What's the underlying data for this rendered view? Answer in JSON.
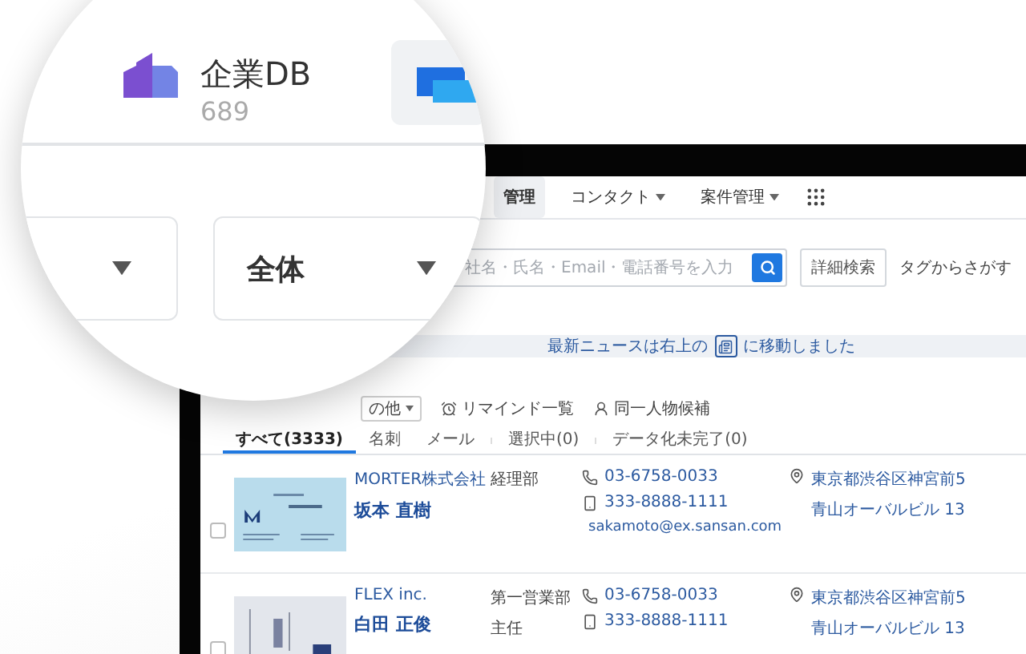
{
  "magnifier": {
    "tab": {
      "label": "企業DB",
      "count": "689"
    },
    "scope_dropdown": {
      "value": "全体"
    }
  },
  "nav": [
    {
      "label": "管理",
      "selected": true,
      "menu": false
    },
    {
      "label": "コンタクト",
      "selected": false,
      "menu": true
    },
    {
      "label": "案件管理",
      "selected": false,
      "menu": true
    }
  ],
  "search": {
    "placeholder": "社名・氏名・Email・電話番号を入力",
    "advanced_button": "詳細検索",
    "tag_link": "タグからさがす"
  },
  "notice": {
    "before": "最新ニュースは右上の",
    "after": "に移動しました"
  },
  "toolbar": [
    {
      "kind": "dropdown",
      "label": "の他"
    },
    {
      "kind": "alarm",
      "label": "リマインド一覧"
    },
    {
      "kind": "person",
      "label": "同一人物候補"
    }
  ],
  "tabs": [
    {
      "label": "すべて(3333)",
      "selected": true
    },
    {
      "label": "名刺",
      "selected": false
    },
    {
      "label": "メール",
      "selected": false
    },
    {
      "label": "選択中(0)",
      "selected": false
    },
    {
      "label": "データ化未完了(0)",
      "selected": false
    }
  ],
  "rows": [
    {
      "checked": false,
      "company": "MORTER株式会社",
      "name": "坂本 直樹",
      "dept": [
        "経理部"
      ],
      "phone": "03-6758-0033",
      "mobile": "333-8888-1111",
      "email": "sakamoto@ex.sansan.com",
      "address": [
        "東京都渋谷区神宮前5",
        "青山オーバルビル 13"
      ]
    },
    {
      "checked": false,
      "company": "FLEX inc.",
      "name": "白田 正俊",
      "dept": [
        "第一営業部",
        "主任"
      ],
      "phone": "03-6758-0033",
      "mobile": "333-8888-1111",
      "address": [
        "東京都渋谷区神宮前5",
        "青山オーバルビル 13"
      ]
    }
  ]
}
